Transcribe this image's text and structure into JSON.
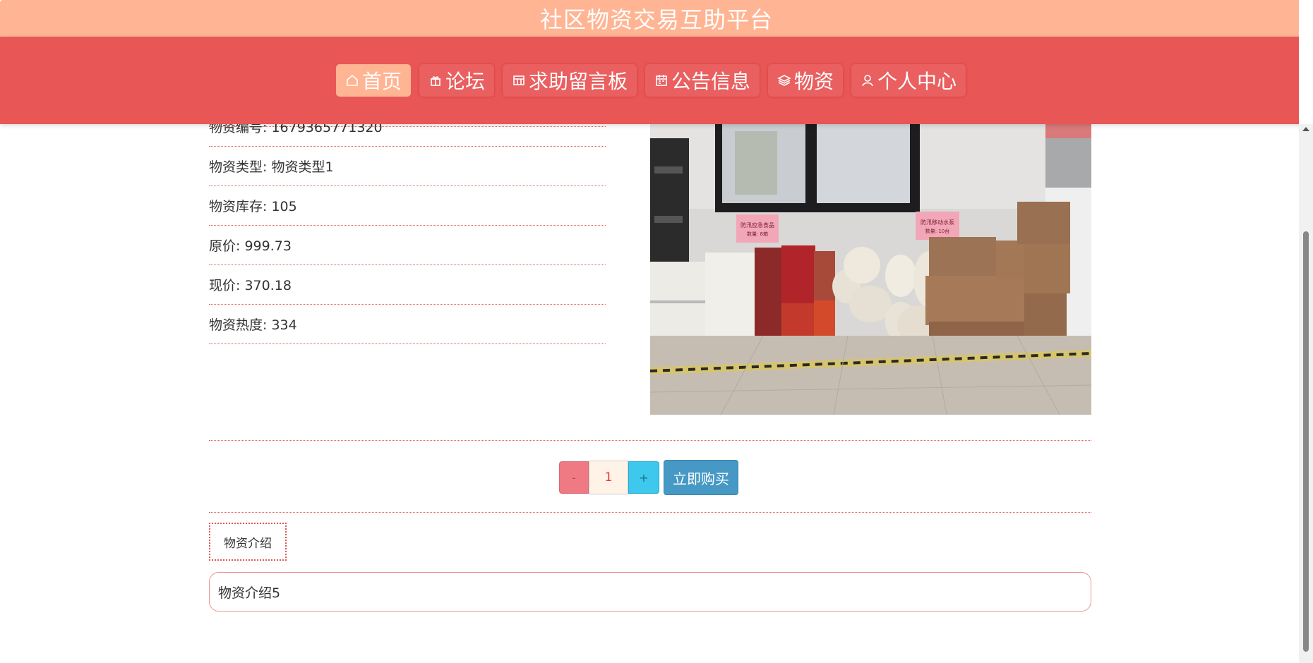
{
  "header": {
    "site_title": "社区物资交易互助平台",
    "nav": [
      {
        "label": "首页",
        "icon": "home-icon",
        "active": true
      },
      {
        "label": "论坛",
        "icon": "gift-icon",
        "active": false
      },
      {
        "label": "求助留言板",
        "icon": "board-icon",
        "active": false
      },
      {
        "label": "公告信息",
        "icon": "calendar-icon",
        "active": false
      },
      {
        "label": "物资",
        "icon": "layers-icon",
        "active": false
      },
      {
        "label": "个人中心",
        "icon": "user-icon",
        "active": false
      }
    ]
  },
  "detail": {
    "rows": [
      "物资编号: 1679365771320",
      "物资类型: 物资类型1",
      "物资库存: 105",
      "原价: 999.73",
      "现价: 370.18",
      "物资热度: 334"
    ],
    "photo": {
      "sign_left": "防汛应急食品",
      "sign_left_sub": "数量: 8箱",
      "sign_right": "防汛移动水泵",
      "sign_right_sub": "数量: 10台"
    }
  },
  "purchase": {
    "minus_label": "-",
    "quantity": "1",
    "plus_label": "+",
    "buy_label": "立即购买"
  },
  "intro": {
    "tab_label": "物资介绍",
    "content": "物资介绍5"
  },
  "colors": {
    "title_bar": "#ffb493",
    "nav_bar": "#e95656",
    "buy_button": "#4599c4",
    "minus_button": "#ef7a84",
    "plus_button": "#3ec8ee"
  }
}
